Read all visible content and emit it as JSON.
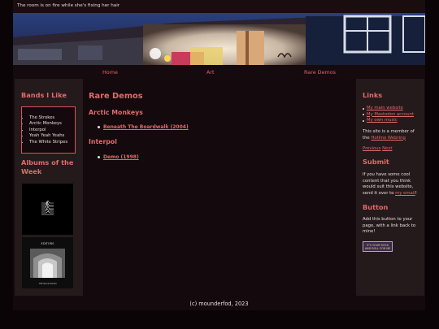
{
  "topbar": {
    "text": "The room is on fire while she's fixing her hair"
  },
  "nav": {
    "items": [
      "Home",
      "Art",
      "Rare Demos"
    ]
  },
  "left_sidebar": {
    "bands_title": "Bands I Like",
    "bands": [
      "The Strokes",
      "Arctic Monkeys",
      "Interpol",
      "Yeah Yeah Yeahs",
      "The White Stripes"
    ],
    "albums_title": "Albums of the Week",
    "album2_text": {
      "band": "EDITORS",
      "title": "THE BACK ROOM"
    }
  },
  "main": {
    "title": "Rare Demos",
    "sections": [
      {
        "heading": "Arctic Monkeys",
        "link": "Beneath The Boardwalk (2004)"
      },
      {
        "heading": "Interpol",
        "link": "Demo (1998)"
      }
    ]
  },
  "right_sidebar": {
    "links_title": "Links",
    "links": [
      "My main website",
      "My Mastodon account",
      "My own music"
    ],
    "webring_prefix": "This site is a member of the",
    "webring_link": "Hotline Webring",
    "prev": "Previous",
    "next": "Next",
    "submit_title": "Submit",
    "submit_text": "If you have some cool content that you think would suit this website, send it over to",
    "submit_link": "my email",
    "submit_end": "!",
    "button_title": "Button",
    "button_text": "Add this button to your page, with a link back to mine!",
    "button_badge": "IT'S YOUR ROCK AND ROLL FOR ME"
  },
  "footer": {
    "text": "(c) mounderfod, 2023"
  },
  "colors": {
    "accent": "#e06a6a",
    "background": "#140a0d",
    "sidebar": "#241a1c"
  }
}
